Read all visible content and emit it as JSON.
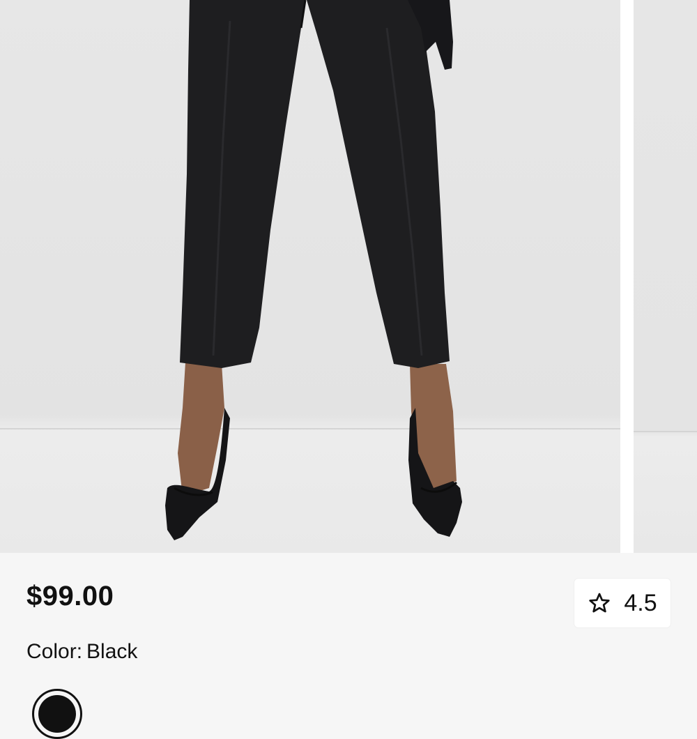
{
  "product": {
    "price": "$99.00",
    "rating": "4.5",
    "color_label": "Color:",
    "color_value": "Black"
  },
  "icons": {
    "rating": "star-outline-icon"
  },
  "colors": {
    "text": "#111111",
    "background": "#f6f6f6",
    "photo_backdrop": "#e5e5e5",
    "garment": "#1c1c1e"
  }
}
